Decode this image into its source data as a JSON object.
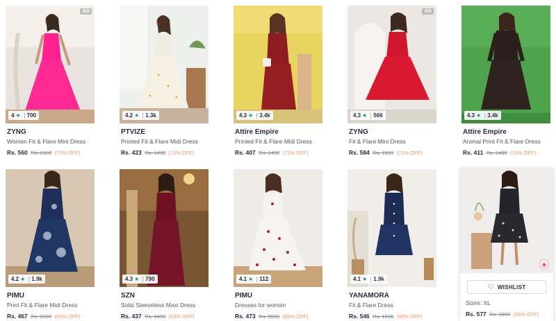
{
  "products_row1": [
    {
      "brand": "ZYNG",
      "title": "Women Fit & Flare Mini Dress",
      "price": "Rs. 560",
      "mrp": "Rs. 2399",
      "off": "(77% OFF)",
      "rating": "4",
      "count": "700",
      "ad": "AD"
    },
    {
      "brand": "PTVIZE",
      "title": "Printed Fit & Flare Midi Dress",
      "price": "Rs. 423",
      "mrp": "Rs. 1499",
      "off": "(72% OFF)",
      "rating": "4.2",
      "count": "1.3k"
    },
    {
      "brand": "Attire Empire",
      "title": "Printed Fit & Flare Midi Dress",
      "price": "Rs. 407",
      "mrp": "Rs. 1499",
      "off": "(73% OFF)",
      "rating": "4.3",
      "count": "3.4k"
    },
    {
      "brand": "ZYNG",
      "title": "Fit & Flare Mini Dress",
      "price": "Rs. 584",
      "mrp": "Rs. 1999",
      "off": "(71% OFF)",
      "rating": "4.3",
      "count": "566",
      "ad": "AD"
    },
    {
      "brand": "Attire Empire",
      "title": "Animal Print Fit & Flare Dress",
      "price": "Rs. 411",
      "mrp": "Rs. 1499",
      "off": "(73% OFF)",
      "rating": "4.3",
      "count": "3.4k"
    }
  ],
  "products_row2": [
    {
      "brand": "PIMU",
      "title": "Print Fit & Flare Midi Dress",
      "price": "Rs. 467",
      "mrp": "Rs. 2999",
      "off": "(84% OFF)",
      "rating": "4.2",
      "count": "1.9k"
    },
    {
      "brand": "SZN",
      "title": "Solid Sleeveless Maxi Dress",
      "price": "Rs. 437",
      "mrp": "Rs. 2499",
      "off": "(83% OFF)",
      "rating": "4.3",
      "count": "790"
    },
    {
      "brand": "PIMU",
      "title": "Dresses for women",
      "price": "Rs. 473",
      "mrp": "Rs. 3999",
      "off": "(88% OFF)",
      "rating": "4.1",
      "count": "112"
    },
    {
      "brand": "YANAMORA",
      "title": "Fit & Flare Dress",
      "price": "Rs. 546",
      "mrp": "Rs. 1696",
      "off": "(68% OFF)",
      "rating": "4.1",
      "count": "1.9k"
    }
  ],
  "hover_product": {
    "wishlist_label": "WISHLIST",
    "sizes": "Sizes: XL",
    "price": "Rs. 577",
    "mrp": "Rs. 1699",
    "off": "(66% OFF)"
  },
  "colors": {
    "rating_star": "#14958f",
    "discount": "#ff905a",
    "text_primary": "#282c3f",
    "text_secondary": "#535766"
  }
}
